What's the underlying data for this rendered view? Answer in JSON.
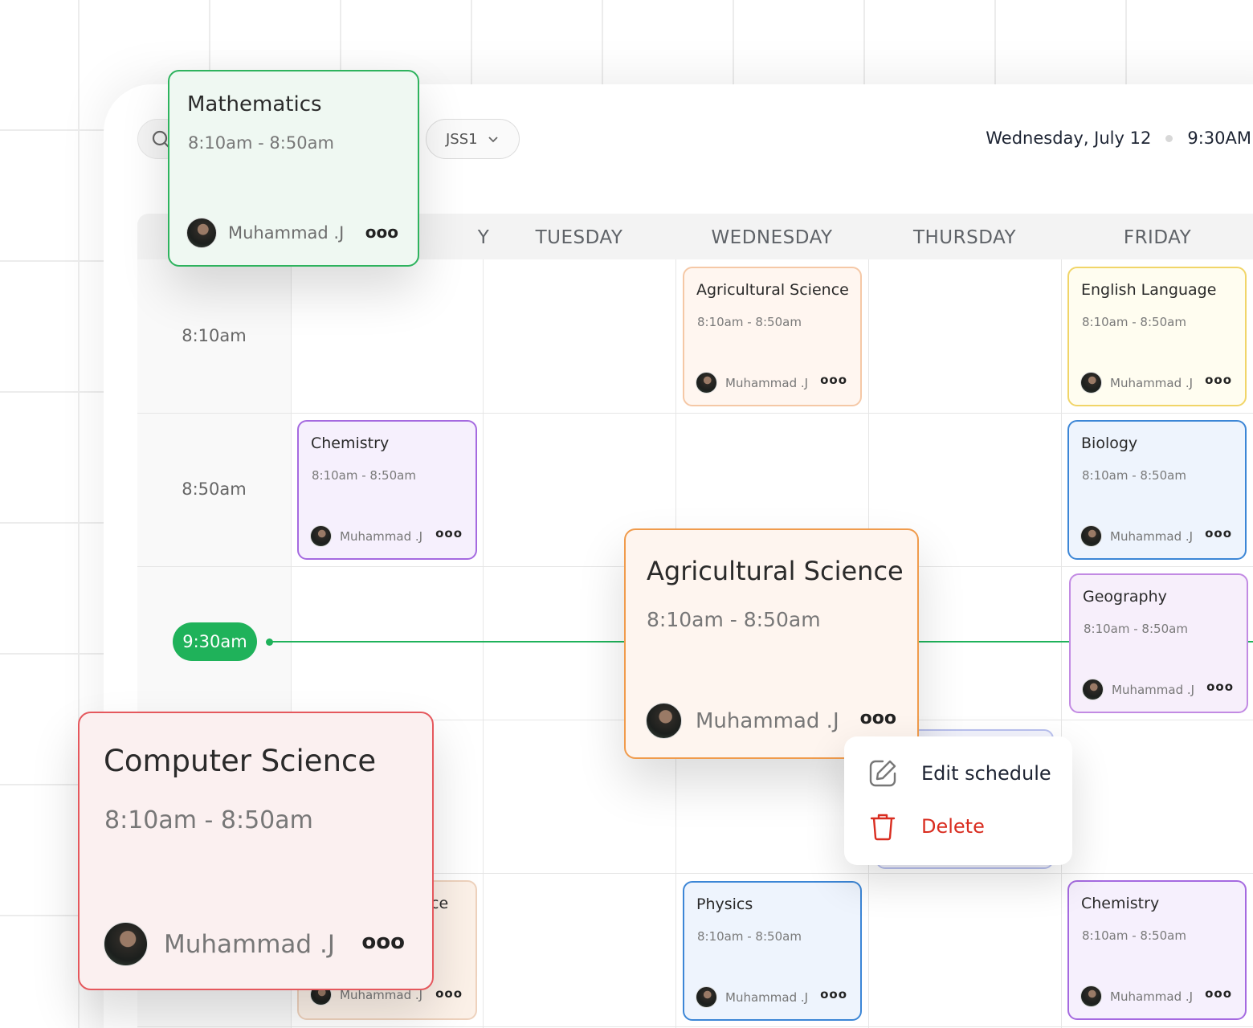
{
  "toolbar": {
    "class_filter": "JSS1",
    "date": "Wednesday, July 12",
    "time": "9:30AM"
  },
  "days": [
    "Y",
    "TUESDAY",
    "WEDNESDAY",
    "THURSDAY",
    "FRIDAY"
  ],
  "time_slots": [
    "8:10am",
    "8:50am",
    "9:30am"
  ],
  "current_time": "9:30am",
  "lessons": {
    "agri_wed": {
      "subject": "Agricultural Science",
      "time": "8:10am - 8:50am",
      "teacher": "Muhammad .J"
    },
    "english_fri": {
      "subject": "English Language",
      "time": "8:10am - 8:50am",
      "teacher": "Muhammad .J"
    },
    "chem_mon": {
      "subject": "Chemistry",
      "time": "8:10am - 8:50am",
      "teacher": "Muhammad .J"
    },
    "bio_fri": {
      "subject": "Biology",
      "time": "8:10am - 8:50am",
      "teacher": "Muhammad .J"
    },
    "geo_fri": {
      "subject": "Geography",
      "time": "8:10am - 8:50am",
      "teacher": "Muhammad .J"
    },
    "mon_bottom": {
      "subject": "nce",
      "teacher": "Muhammad .J"
    },
    "phys_wed": {
      "subject": "Physics",
      "time": "8:10am - 8:50am",
      "teacher": "Muhammad .J"
    },
    "chem_fri": {
      "subject": "Chemistry",
      "time": "8:10am - 8:50am",
      "teacher": "Muhammad .J"
    }
  },
  "floating_cards": {
    "math": {
      "subject": "Mathematics",
      "time": "8:10am - 8:50am",
      "teacher": "Muhammad .J"
    },
    "agri": {
      "subject": "Agricultural Science",
      "time": "8:10am - 8:50am",
      "teacher": "Muhammad .J"
    },
    "cs": {
      "subject": "Computer Science",
      "time": "8:10am - 8:50am",
      "teacher": "Muhammad .J"
    }
  },
  "context_menu": {
    "edit_label": "Edit schedule",
    "delete_label": "Delete"
  },
  "colors": {
    "accent_green": "#1fb25a",
    "delete_red": "#d92d20"
  }
}
